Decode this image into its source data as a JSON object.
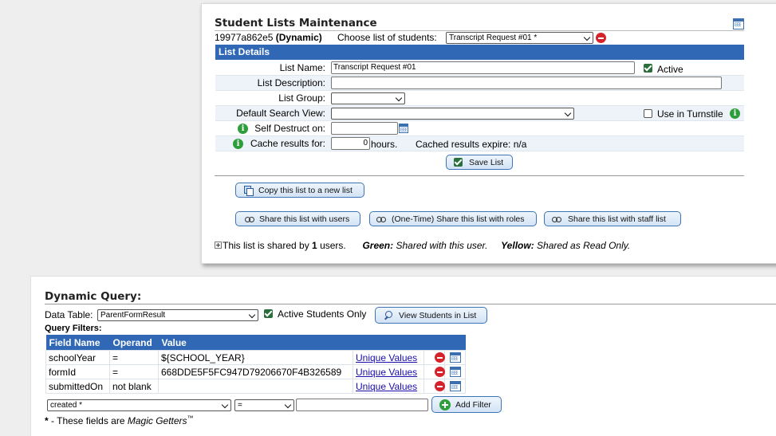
{
  "maintenance": {
    "title": "Student Lists Maintenance",
    "list_id": "19977a862e5",
    "list_type": "(Dynamic)",
    "choose_label": "Choose list of students:",
    "choose_value": "Transcript Request #01 *",
    "section_header": "List Details",
    "fields": {
      "list_name_label": "List Name:",
      "list_name_value": "Transcript Request #01",
      "active_label": "Active",
      "list_description_label": "List Description:",
      "list_group_label": "List Group:",
      "default_search_view_label": "Default Search View:",
      "use_in_turnstile_label": "Use in Turnstile",
      "self_destruct_label": "Self Destruct on:",
      "cache_label": "Cache results for:",
      "cache_value": "0",
      "hours_label": "hours.",
      "cached_expire_text": "Cached results expire: n/a"
    },
    "save_button": "Save List",
    "copy_button": "Copy this list to a new list",
    "share_users_button": "Share this list with users",
    "share_roles_button": "(One-Time) Share this list with roles",
    "share_staff_button": "Share this list with staff list",
    "shared_prefix": "This list is shared by",
    "shared_count": "1",
    "shared_suffix": "users.",
    "legend_green_label": "Green:",
    "legend_green_text": "Shared with this user.",
    "legend_yellow_label": "Yellow:",
    "legend_yellow_text": "Shared as Read Only."
  },
  "query": {
    "title": "Dynamic Query:",
    "data_table_label": "Data Table:",
    "data_table_value": "ParentFormResult",
    "active_only_label": "Active Students Only",
    "view_students_button": "View Students in List",
    "filters_label": "Query Filters:",
    "columns": [
      "Field Name",
      "Operand",
      "Value"
    ],
    "rows": [
      {
        "field": "schoolYear",
        "operand": "=",
        "value": "${SCHOOL_YEAR}",
        "link": "Unique Values"
      },
      {
        "field": "formId",
        "operand": "=",
        "value": "668DDE5F5FC947D79206670F4B326589",
        "link": "Unique Values"
      },
      {
        "field": "submittedOn",
        "operand": "not blank",
        "value": "",
        "link": "Unique Values"
      }
    ],
    "new_filter_field": "created *",
    "new_filter_operand": "=",
    "add_filter_button": "Add Filter",
    "footnote_star": "*",
    "footnote_text": " - These fields are ",
    "footnote_em": "Magic Getters",
    "footnote_tm": "™"
  },
  "colors": {
    "header_blue": "#3068b6",
    "button_border": "#3d74b5",
    "remove_red": "#d6232b",
    "info_green": "#2e9e3a",
    "check_green": "#2a6e3c"
  }
}
